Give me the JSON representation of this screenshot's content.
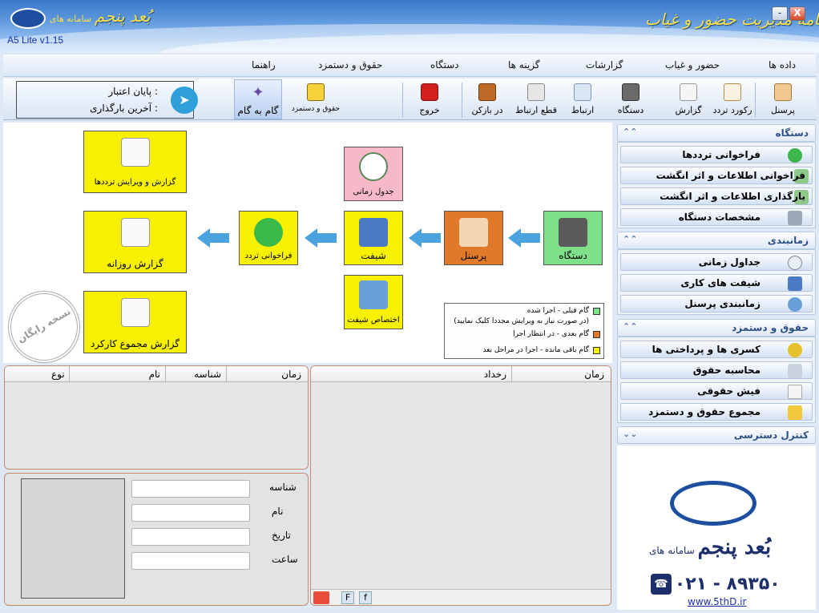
{
  "window": {
    "brand_small": "سامانه های",
    "brand_large": "بُعد پنجم",
    "app_title": "برنامه مدیریت حضور و غیاب",
    "version": "A5 Lite v1.15",
    "minimize": "-",
    "close": "X"
  },
  "menu": [
    "داده ها",
    "حضور و غیاب",
    "گزارشات",
    "گزینه ها",
    "دستگاه",
    "حقوق و دستمزد",
    "راهنما"
  ],
  "toolbar": {
    "personnel": "پرسنل",
    "record": "رکورد تردد",
    "report": "گزارش",
    "device": "دستگاه",
    "connect": "ارتباط",
    "disconnect": "قطع ارتباط",
    "open": "در بازکن",
    "exit": "خروج",
    "payroll": "حقوق و دستمزد",
    "step": "گام به گام",
    "expiry_label": "پایان اعتبار :",
    "last_load_label": "آخرین بارگذاری :"
  },
  "sidebar": {
    "device": {
      "title": "دستگاه",
      "items": [
        "فراخوانی ترددها",
        "فراخوانی اطلاعات و اثر انگشت",
        "بارگذاری اطلاعات و اثر انگشت",
        "مشخصات دستگاه"
      ]
    },
    "timing": {
      "title": "زمانبندی",
      "items": [
        "جداول زمانی",
        "شیفت های کاری",
        "زمانبندی پرسنل"
      ]
    },
    "payroll": {
      "title": "حقوق و دستمزد",
      "items": [
        "کسری ها و پرداختی ها",
        "محاسبه حقوق",
        "فیش حقوقی",
        "مجموع حقوق و دستمزد"
      ]
    },
    "access": {
      "title": "کنترل دسترسی"
    }
  },
  "flow": {
    "device": "دستگاه",
    "personnel": "پرسنل",
    "shift": "شیفت",
    "time_table": "جدول زمانی",
    "assign_shift": "اختصاص شیفت",
    "fetch": "فراخوانی تردد",
    "edit_report": "گزارش و ویرایش ترددها",
    "daily_report": "گزارش روزانه",
    "total_report": "گزارش مجموع کارکرد",
    "stamp": "نسخه رایگان"
  },
  "legend": {
    "done": "گام قبلی - اجرا شده",
    "done_note": "(در صورت نیاز به ویرایش مجددا کلیک نمایید)",
    "next": "گام بعدی - در انتظار اجرا",
    "later": "گام باقی مانده - اجرا در مراحل بعد",
    "colors": {
      "done": "#7fe08a",
      "next": "#e07a2a",
      "later": "#f7f000"
    }
  },
  "left_grid": {
    "columns": [
      "زمان",
      "شناسه",
      "نام",
      "نوع"
    ]
  },
  "right_grid": {
    "columns": [
      "زمان",
      "رخداد"
    ]
  },
  "person_form": {
    "id": "شناسه",
    "name": "نام",
    "date": "تاریخ",
    "time": "ساعت"
  },
  "bottom_buttons": [
    "F",
    "f"
  ],
  "logo": {
    "small": "سامانه های",
    "large": "بُعد پنجم",
    "phone": "۰۲۱ - ۸۹۳۵۰",
    "url": "www.5thD.ir"
  }
}
